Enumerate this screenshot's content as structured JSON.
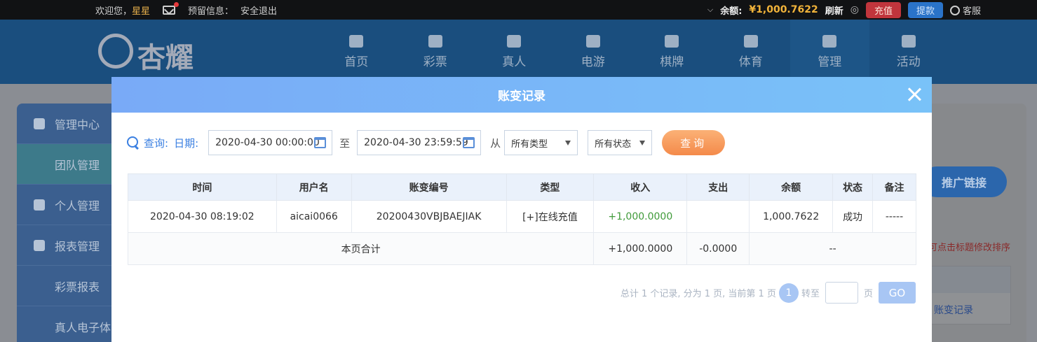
{
  "topbar": {
    "welcome": "欢迎您，",
    "username": "星星",
    "warning_label": "预留信息：",
    "logout": "安全退出",
    "balance_label": "余额:",
    "balance_amount": "¥1,000.7622",
    "refresh": "刷新",
    "recharge": "充值",
    "withdraw": "提款",
    "customer_service": "客服"
  },
  "header": {
    "logo_text": "杏耀",
    "nav": [
      "首页",
      "彩票",
      "真人",
      "电游",
      "棋牌",
      "体育",
      "管理",
      "活动"
    ],
    "active_nav": "管理"
  },
  "sidebar": {
    "items": [
      {
        "label": "管理中心",
        "type": "section"
      },
      {
        "label": "团队管理",
        "type": "sub",
        "active": true
      },
      {
        "label": "个人管理",
        "type": "section"
      },
      {
        "label": "报表管理",
        "type": "section"
      },
      {
        "label": "彩票报表",
        "type": "sub"
      },
      {
        "label": "真人电子体",
        "type": "sub"
      }
    ]
  },
  "right_panel": {
    "promo": "推广链接",
    "hint": "可点击标题修改排序",
    "link": "账变记录"
  },
  "modal": {
    "title": "账变记录",
    "filters": {
      "query_label": "查询:",
      "date_label": "日期:",
      "start_date": "2020-04-30 00:00:00",
      "to_label": "至",
      "end_date": "2020-04-30 23:59:59",
      "from_label": "从",
      "type_select": "所有类型",
      "status_select": "所有状态",
      "query_button": "查询"
    },
    "table": {
      "headers": [
        "时间",
        "用户名",
        "账变编号",
        "类型",
        "收入",
        "支出",
        "余额",
        "状态",
        "备注"
      ],
      "rows": [
        [
          "2020-04-30 08:19:02",
          "aicai0066",
          "20200430VBJBAEJIAK",
          "[+]在线充值",
          "+1,000.0000",
          "",
          "1,000.7622",
          "成功",
          "-----"
        ]
      ],
      "total": {
        "label": "本页合计",
        "income": "+1,000.0000",
        "expense": "-0.0000",
        "balance": "--"
      }
    },
    "pager": {
      "summary": "总计 1 个记录, 分为 1 页, 当前第 1 页",
      "current_page": "1",
      "goto_label": "转至",
      "page_unit": "页",
      "go_button": "GO"
    }
  },
  "colors": {
    "modal_header_start": "#79aaf7",
    "modal_header_end": "#79c2f8",
    "accent_blue": "#3a7fe1",
    "income_green": "#3f9a39",
    "query_orange": "#f48a4a",
    "balance_gold": "#f1b33a"
  }
}
